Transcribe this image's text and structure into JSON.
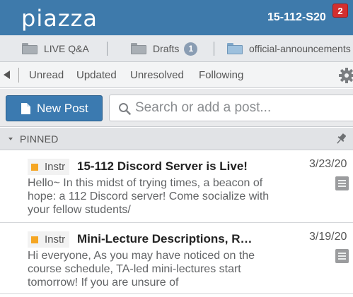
{
  "header": {
    "logo": "piazza",
    "course": "15-112-S20",
    "notification_count": "2"
  },
  "folders": [
    {
      "label": "LIVE Q&A",
      "badge": ""
    },
    {
      "label": "Drafts",
      "badge": "1"
    },
    {
      "label": "official-announcements",
      "badge": ""
    }
  ],
  "filters": [
    "Unread",
    "Updated",
    "Unresolved",
    "Following"
  ],
  "actions": {
    "new_post_label": "New Post",
    "search_placeholder": "Search or add a post..."
  },
  "pinned": {
    "label": "PINNED"
  },
  "posts": [
    {
      "tag": "Instr",
      "title": "15-112 Discord Server is Live!",
      "date": "3/23/20",
      "body": "Hello~ In this midst of trying times, a beacon of hope: a 112 Discord server! Come socialize with your fellow students/"
    },
    {
      "tag": "Instr",
      "title": "Mini-Lecture Descriptions, R…",
      "date": "3/19/20",
      "body": "Hi everyone, As you may have noticed on the course schedule, TA-led mini-lectures start tomorrow! If you are unsure of"
    }
  ],
  "colors": {
    "header_bg": "#3e7aab",
    "new_post_bg": "#3b7ab0",
    "notification_badge": "#d32f2f",
    "instructor_tag": "#f5a623"
  },
  "icons": [
    "folder-icon",
    "left-arrow-icon",
    "gear-icon",
    "document-icon",
    "search-icon",
    "pin-icon",
    "note-icon"
  ]
}
